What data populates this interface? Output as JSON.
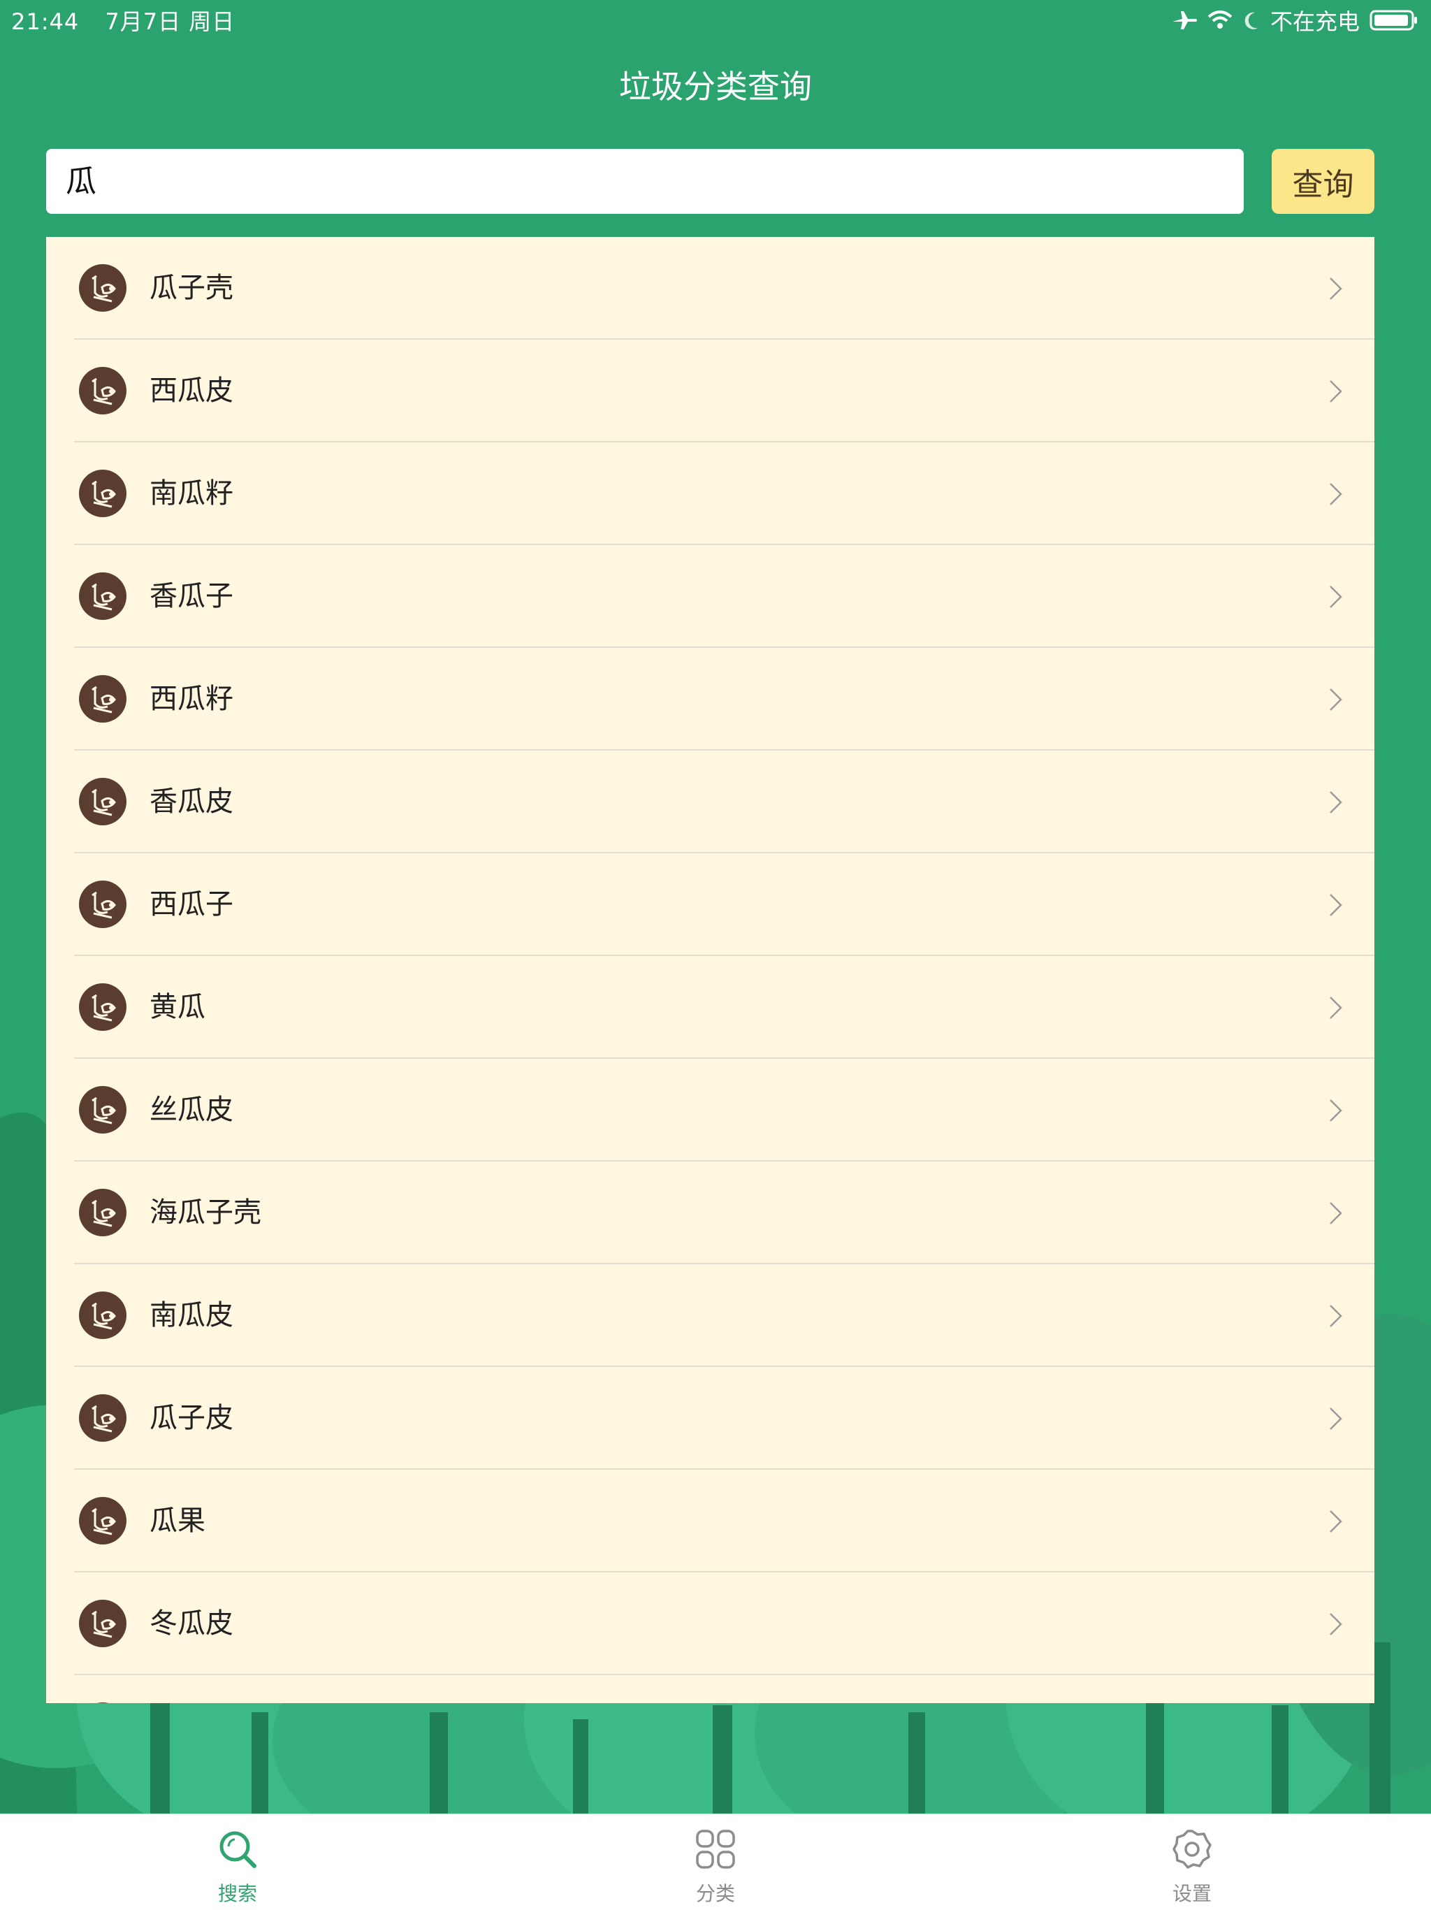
{
  "status_bar": {
    "time": "21:44",
    "date": "7月7日 周日",
    "charging": "不在充电",
    "icons": [
      "airplane-icon",
      "wifi-icon",
      "moon-icon",
      "battery-icon"
    ]
  },
  "header": {
    "title": "垃圾分类查询"
  },
  "search": {
    "value": "瓜",
    "button_label": "查询"
  },
  "results": [
    {
      "label": "瓜子壳"
    },
    {
      "label": "西瓜皮"
    },
    {
      "label": "南瓜籽"
    },
    {
      "label": "香瓜子"
    },
    {
      "label": "西瓜籽"
    },
    {
      "label": "香瓜皮"
    },
    {
      "label": "西瓜子"
    },
    {
      "label": "黄瓜"
    },
    {
      "label": "丝瓜皮"
    },
    {
      "label": "海瓜子壳"
    },
    {
      "label": "南瓜皮"
    },
    {
      "label": "瓜子皮"
    },
    {
      "label": "瓜果"
    },
    {
      "label": "冬瓜皮"
    }
  ],
  "tabs": [
    {
      "label": "搜索",
      "icon": "search-icon",
      "active": true
    },
    {
      "label": "分类",
      "icon": "grid-icon",
      "active": false
    },
    {
      "label": "设置",
      "icon": "gear-icon",
      "active": false
    }
  ],
  "colors": {
    "primary_green": "#2aa36f",
    "list_background": "#fff7e0",
    "button_yellow": "#fbe78a",
    "active_tab": "#2fa46f",
    "avatar_brown": "#5a3d2f"
  }
}
